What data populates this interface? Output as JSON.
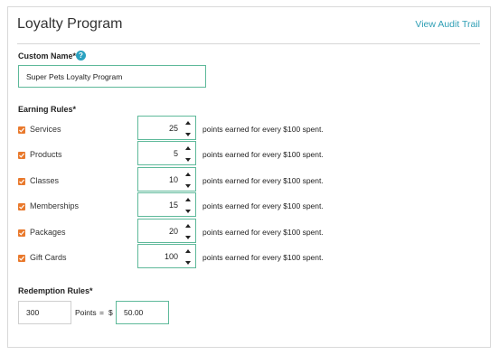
{
  "header": {
    "title": "Loyalty Program",
    "audit_link": "View Audit Trail"
  },
  "custom_name": {
    "label": "Custom Name*",
    "help_icon": "question-mark",
    "value": "Super Pets Loyalty Program"
  },
  "earning_rules": {
    "label": "Earning Rules*",
    "suffix": "points earned for every $100 spent.",
    "items": [
      {
        "label": "Services",
        "checked": true,
        "value": "25"
      },
      {
        "label": "Products",
        "checked": true,
        "value": "5"
      },
      {
        "label": "Classes",
        "checked": true,
        "value": "10"
      },
      {
        "label": "Memberships",
        "checked": true,
        "value": "15"
      },
      {
        "label": "Packages",
        "checked": true,
        "value": "20"
      },
      {
        "label": "Gift Cards",
        "checked": true,
        "value": "100"
      }
    ]
  },
  "redemption_rules": {
    "label": "Redemption Rules*",
    "points_value": "300",
    "points_label": "Points",
    "equals": "=",
    "currency": "$",
    "dollar_value": "50.00"
  },
  "colors": {
    "accent": "#2f9fb5",
    "checkbox": "#e9792c",
    "input_border_active": "#5eb99a"
  }
}
